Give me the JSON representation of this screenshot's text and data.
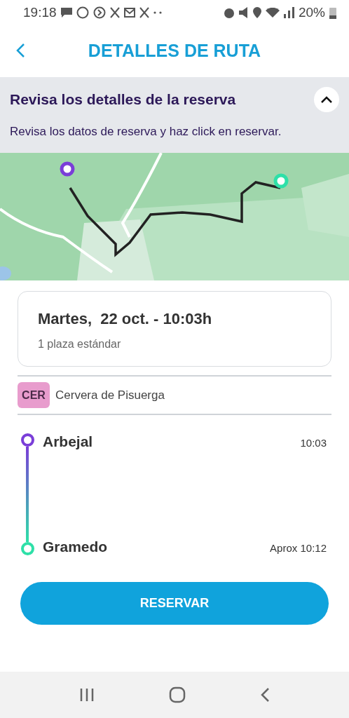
{
  "status_bar": {
    "time": "19:18",
    "battery": "20%"
  },
  "header": {
    "title": "DETALLES DE RUTA"
  },
  "notice": {
    "title": "Revisa los detalles de la reserva",
    "text": "Revisa los datos de reserva y haz click en reservar.",
    "expanded": true
  },
  "trip_card": {
    "date": "Martes,  22 oct. - 10:03h",
    "seats": "1 plaza estándar"
  },
  "operator": {
    "badge": "CER",
    "color": "#e89ccd",
    "name": "Cervera de Pisuerga"
  },
  "stops": [
    {
      "name": "Arbejal",
      "time": "10:03",
      "color": "#7a3ed8"
    },
    {
      "name": "Gramedo",
      "time": "Aprox 10:12",
      "color": "#2ee0a8"
    }
  ],
  "action": {
    "label": "RESERVAR"
  }
}
